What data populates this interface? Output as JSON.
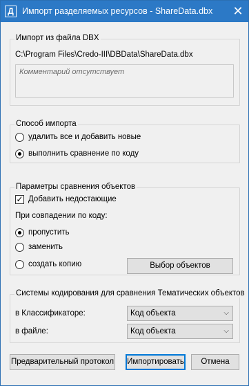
{
  "window": {
    "title": "Импорт разделяемых ресурсов - ShareData.dbx",
    "app_icon": "Д",
    "close_glyph": "✕"
  },
  "import_dbx": {
    "title": "Импорт из файла DBX",
    "path": "C:\\Program Files\\Credo-III\\DBData\\ShareData.dbx",
    "comment": "Комментарий отсутствует"
  },
  "import_method": {
    "title": "Способ импорта",
    "options": [
      {
        "label": "удалить все и добавить новые",
        "checked": false
      },
      {
        "label": "выполнить сравнение по коду",
        "checked": true
      }
    ]
  },
  "compare_params": {
    "title": "Параметры сравнения объектов",
    "add_missing": {
      "label": "Добавить недостающие",
      "checked": true,
      "mark": "✓"
    },
    "on_match_label": "При совпадении по коду:",
    "options": [
      {
        "label": "пропустить",
        "checked": true
      },
      {
        "label": "заменить",
        "checked": false
      },
      {
        "label": "создать копию",
        "checked": false
      }
    ],
    "select_objects_button": "Выбор объектов"
  },
  "coding_systems": {
    "title": "Системы кодирования для сравнения Тематических объектов",
    "classifier_label": "в Классификаторе:",
    "classifier_value": "Код объекта",
    "file_label": "в файле:",
    "file_value": "Код объекта",
    "arrow_glyph": "⌵"
  },
  "footer": {
    "preview_button": "Предварительный протокол",
    "import_button": "Импортировать",
    "cancel_button": "Отмена"
  }
}
